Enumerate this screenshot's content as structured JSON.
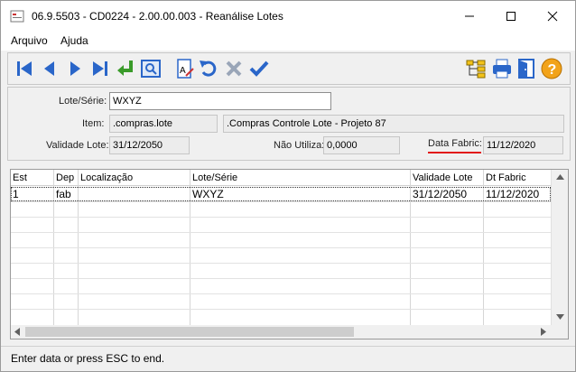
{
  "window": {
    "title": "06.9.5503 - CD0224 - 2.00.00.003 - Reanálise Lotes"
  },
  "menu": {
    "items": [
      "Arquivo",
      "Ajuda"
    ]
  },
  "toolbar": {
    "left_icons": [
      "first-record-icon",
      "previous-record-icon",
      "next-record-icon",
      "last-record-icon",
      "goto-icon",
      "search-icon",
      "edit-document-icon",
      "undo-icon",
      "delete-icon",
      "confirm-icon"
    ],
    "right_icons": [
      "tree-structure-icon",
      "print-icon",
      "exit-door-icon",
      "help-icon"
    ]
  },
  "form": {
    "lote_label": "Lote/Série:",
    "lote_value": "WXYZ",
    "item_label": "Item:",
    "item_code": ".compras.lote",
    "item_desc": ".Compras Controle Lote - Projeto 87",
    "validade_label": "Validade Lote:",
    "validade_value": "31/12/2050",
    "nao_utiliza_label": "Não Utiliza:",
    "nao_utiliza_value": "0,0000",
    "data_fabric_label": "Data Fabric:",
    "data_fabric_value": "11/12/2020"
  },
  "grid": {
    "columns": [
      "Est",
      "Dep",
      "Localização",
      "Lote/Série",
      "Validade Lote",
      "Dt Fabric"
    ],
    "rows": [
      {
        "est": "1",
        "dep": "fab",
        "localizacao": "",
        "lote": "WXYZ",
        "validade": "31/12/2050",
        "fabric": "11/12/2020"
      }
    ]
  },
  "colors": {
    "toolbar_blue": "#2a66c9",
    "confirm_green": "#3a9b2a",
    "help_orange": "#f2a31a",
    "highlight_red": "#e21b1b"
  },
  "status": {
    "text": "Enter data or press ESC to end."
  }
}
